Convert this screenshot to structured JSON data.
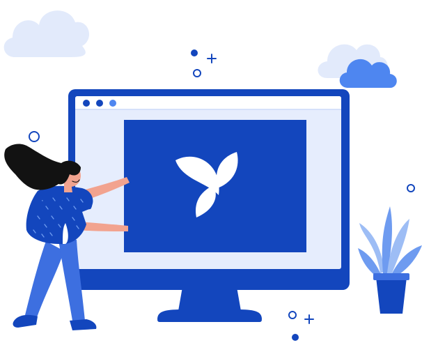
{
  "scene": {
    "subject": "illustration",
    "logo": "leaf-logo",
    "window_controls": [
      "close-dot",
      "minimize-dot",
      "maximize-dot"
    ],
    "decorations": [
      "cloud-left",
      "cloud-right",
      "plant",
      "sparkles"
    ]
  },
  "colors": {
    "primary": "#1346BD",
    "secondary": "#3D6FE0",
    "light": "#E6EDFD",
    "cloud": "#E0E9FC",
    "cloud_blue": "#4E86F0",
    "hair": "#121212",
    "skin": "#F2A38F",
    "white": "#FFFFFF"
  }
}
